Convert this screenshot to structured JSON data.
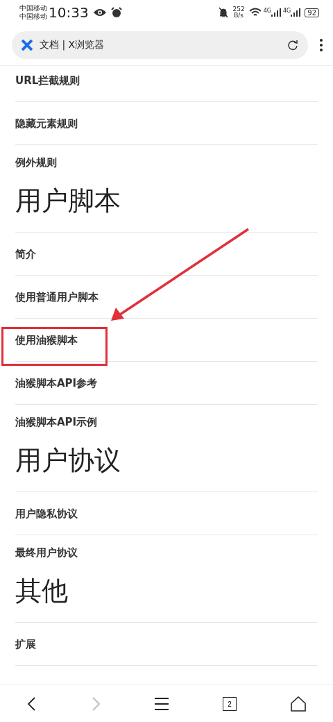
{
  "status_bar": {
    "carriers": [
      "中国移动",
      "中国移动"
    ],
    "time": "10:33",
    "speed": "252\nB/s",
    "network_1": "4G",
    "network_2": "4G",
    "battery": "92"
  },
  "address_bar": {
    "title": "文档 | X浏览器"
  },
  "entries": [
    {
      "kind": "link",
      "label": "URL拦截规则"
    },
    {
      "kind": "link",
      "label": "隐藏元素规则"
    },
    {
      "kind": "link",
      "label": "例外规则"
    },
    {
      "kind": "heading",
      "label": "用户脚本"
    },
    {
      "kind": "link",
      "label": "简介"
    },
    {
      "kind": "link",
      "label": "使用普通用户脚本"
    },
    {
      "kind": "link",
      "label": "使用油猴脚本"
    },
    {
      "kind": "link",
      "label": "油猴脚本API参考"
    },
    {
      "kind": "link",
      "label": "油猴脚本API示例"
    },
    {
      "kind": "heading",
      "label": "用户协议"
    },
    {
      "kind": "link",
      "label": "用户隐私协议"
    },
    {
      "kind": "link",
      "label": "最终用户协议"
    },
    {
      "kind": "heading",
      "label": "其他"
    },
    {
      "kind": "link",
      "label": "扩展"
    }
  ],
  "annotations": {
    "highlight_box": true,
    "arrow": true
  },
  "bottom_nav": {
    "forward_disabled": true,
    "tab_count": "2"
  }
}
